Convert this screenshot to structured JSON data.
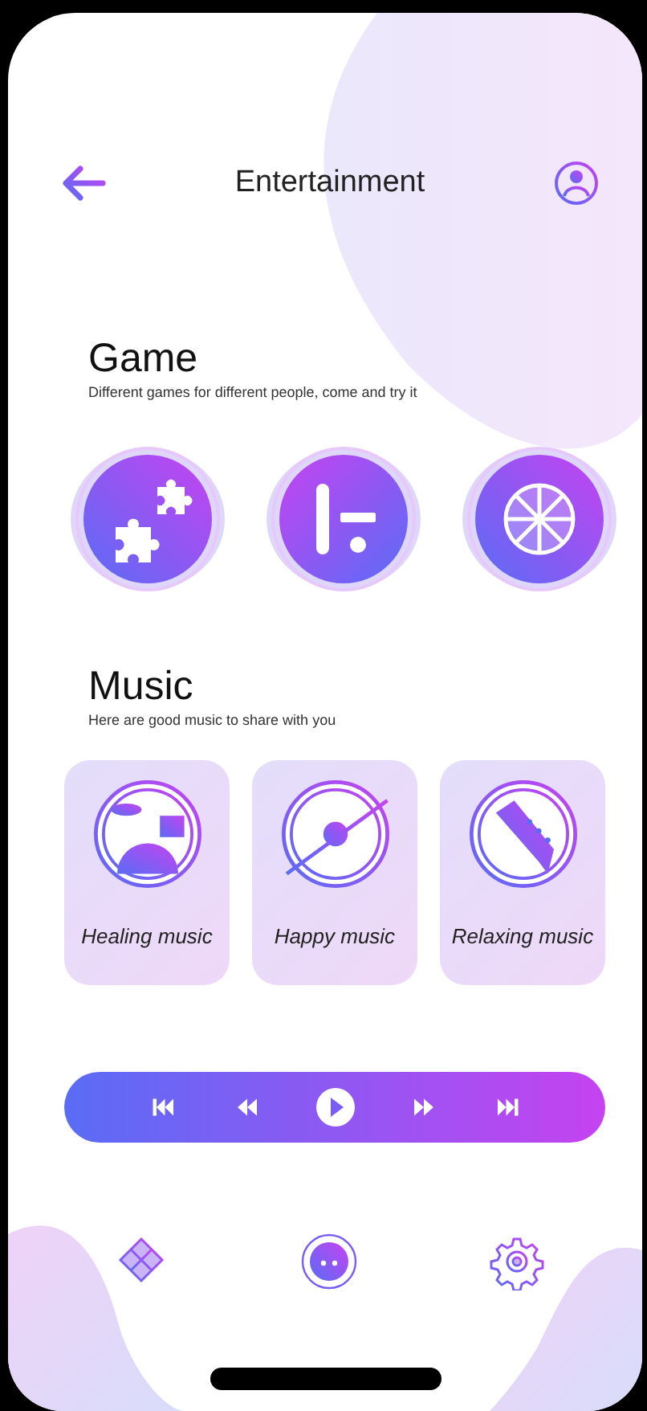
{
  "header": {
    "title": "Entertainment"
  },
  "game": {
    "title": "Game",
    "subtitle": "Different games for different people, come and try it",
    "items": [
      {
        "kind": "puzzle"
      },
      {
        "kind": "bars"
      },
      {
        "kind": "wheel"
      }
    ]
  },
  "music": {
    "title": "Music",
    "subtitle": "Here are good music to share with you",
    "cards": [
      {
        "kind": "drums",
        "label": "Healing music"
      },
      {
        "kind": "drum",
        "label": "Happy music"
      },
      {
        "kind": "guitar",
        "label": "Relaxing music"
      }
    ]
  },
  "player": {
    "controls": [
      {
        "kind": "first"
      },
      {
        "kind": "rewind"
      },
      {
        "kind": "play"
      },
      {
        "kind": "forward"
      },
      {
        "kind": "last"
      }
    ]
  },
  "nav": [
    {
      "kind": "diamond",
      "selected": false
    },
    {
      "kind": "face",
      "selected": true
    },
    {
      "kind": "gear",
      "selected": false
    }
  ]
}
